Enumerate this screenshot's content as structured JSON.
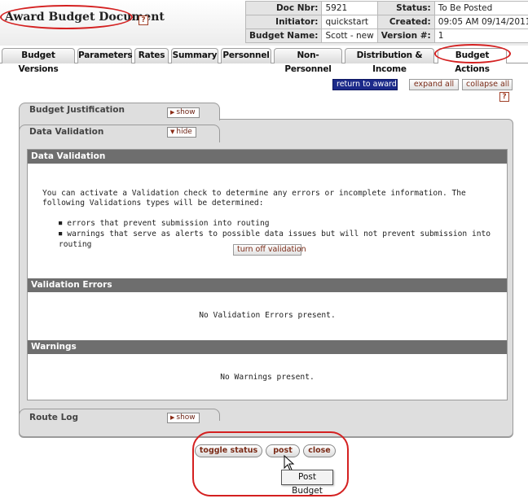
{
  "header": {
    "title": "Award Budget Document",
    "help_label": "?",
    "info": {
      "doc_nbr_label": "Doc Nbr:",
      "doc_nbr": "5921",
      "status_label": "Status:",
      "status": "To Be Posted",
      "initiator_label": "Initiator:",
      "initiator": "quickstart",
      "created_label": "Created:",
      "created": "09:05 AM 09/14/2011",
      "budget_name_label": "Budget Name:",
      "budget_name": "Scott - new",
      "version_label": "Version #:",
      "version": "1"
    }
  },
  "tabs": [
    {
      "label": "Budget Versions"
    },
    {
      "label": "Parameters"
    },
    {
      "label": "Rates"
    },
    {
      "label": "Summary"
    },
    {
      "label": "Personnel"
    },
    {
      "label": "Non-Personnel"
    },
    {
      "label": "Distribution & Income"
    },
    {
      "label": "Budget Actions",
      "active": true
    }
  ],
  "actions": {
    "return_label": "return to award",
    "expand_label": "expand all",
    "collapse_label": "collapse all",
    "help_label": "?"
  },
  "panels": {
    "justification": {
      "title": "Budget Justification",
      "toggle": "show"
    },
    "validation": {
      "title": "Data Validation",
      "toggle": "hide",
      "section_title": "Data Validation",
      "intro": "You can activate a Validation check to determine any errors or incomplete information. The following Validations types will be determined:",
      "bullets": [
        "errors that prevent submission into routing",
        "warnings that serve as alerts to possible data issues but will not prevent submission into routing"
      ],
      "turn_off_label": "turn off validation",
      "errors_title": "Validation Errors",
      "errors_msg": "No Validation Errors present.",
      "warnings_title": "Warnings",
      "warnings_msg": "No Warnings present."
    },
    "route_log": {
      "title": "Route Log",
      "toggle": "show"
    }
  },
  "bottom_buttons": {
    "toggle_status": "toggle status",
    "post": "post",
    "close": "close",
    "tooltip": "Post Budget"
  },
  "colors": {
    "annotation": "#d42020",
    "button_text": "#7a2a16",
    "section_header": "#6e6e6e",
    "return_button": "#1c2a8a"
  }
}
